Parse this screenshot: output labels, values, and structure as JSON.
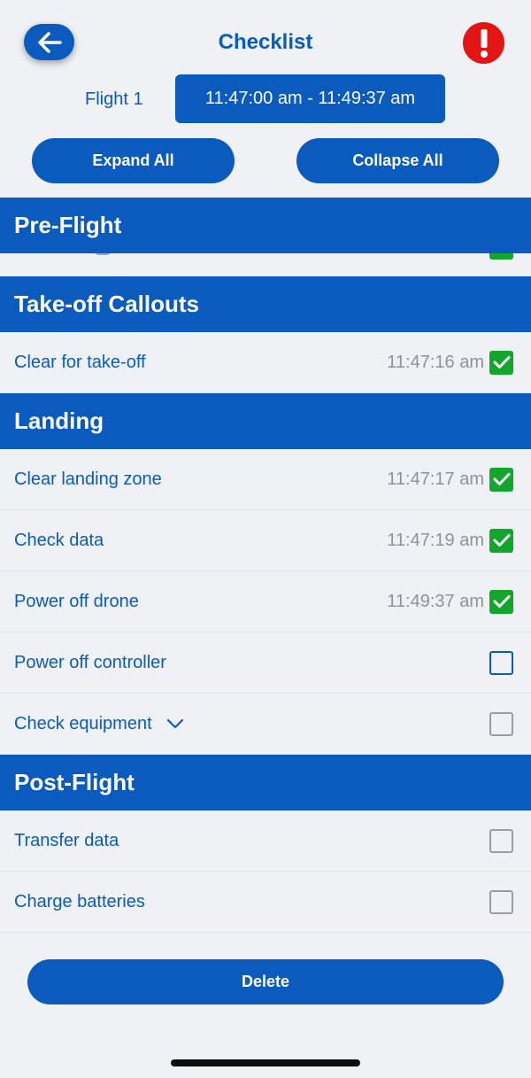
{
  "header": {
    "title": "Checklist",
    "back_icon": "arrow-left-icon",
    "alert_icon": "exclamation-icon"
  },
  "flight": {
    "label": "Flight 1",
    "time_range": "11:47:00 am - 11:49:37 am"
  },
  "actions": {
    "expand_all": "Expand All",
    "collapse_all": "Collapse All",
    "delete": "Delete"
  },
  "sections": {
    "pre_flight": {
      "title": "Pre-Flight"
    },
    "takeoff": {
      "title": "Take-off Callouts",
      "items": [
        {
          "label": "Clear for take-off",
          "time": "11:47:16 am",
          "checked": true
        }
      ]
    },
    "landing": {
      "title": "Landing",
      "items": [
        {
          "label": "Clear landing zone",
          "time": "11:47:17 am",
          "checked": true
        },
        {
          "label": "Check data",
          "time": "11:47:19 am",
          "checked": true
        },
        {
          "label": "Power off drone",
          "time": "11:49:37 am",
          "checked": true
        },
        {
          "label": "Power off controller",
          "time": "",
          "checked": false
        },
        {
          "label": "Check equipment",
          "time": "",
          "checked": false,
          "expandable": true
        }
      ]
    },
    "post_flight": {
      "title": "Post-Flight",
      "items": [
        {
          "label": "Transfer data",
          "time": "",
          "checked": false
        },
        {
          "label": "Charge batteries",
          "time": "",
          "checked": false
        }
      ]
    }
  },
  "colors": {
    "primary": "#0a5bbd",
    "check": "#13a62d",
    "alert": "#e41414",
    "background": "#eff1f5",
    "timestamp": "#8f9399"
  }
}
